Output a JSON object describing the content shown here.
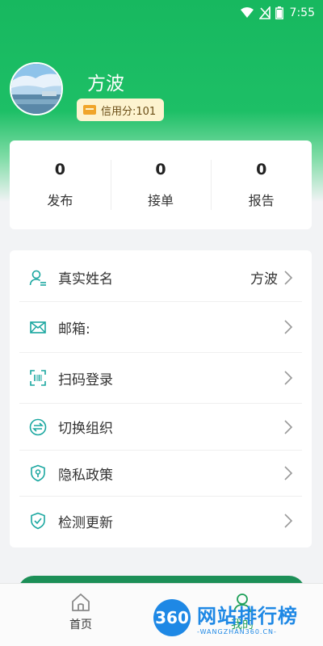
{
  "status_bar": {
    "time": "7:55"
  },
  "profile": {
    "name": "方波",
    "credit": "信用分:101"
  },
  "stats": [
    {
      "value": "0",
      "label": "发布"
    },
    {
      "value": "0",
      "label": "接单"
    },
    {
      "value": "0",
      "label": "报告"
    }
  ],
  "menu": [
    {
      "label": "真实姓名",
      "value": "方波",
      "icon": "user-id-icon"
    },
    {
      "label": "邮箱:",
      "value": "",
      "icon": "mail-icon"
    },
    {
      "label": "扫码登录",
      "value": "",
      "icon": "scan-icon"
    },
    {
      "label": "切换组织",
      "value": "",
      "icon": "switch-icon"
    },
    {
      "label": "隐私政策",
      "value": "",
      "icon": "shield-lock-icon"
    },
    {
      "label": "检测更新",
      "value": "",
      "icon": "shield-check-icon"
    }
  ],
  "tabbar": {
    "home": "首页",
    "mine": "我的"
  },
  "watermark": {
    "logo": "360",
    "title": "网站排行榜",
    "sub": "-WANGZHAN360.CN-"
  },
  "colors": {
    "primary": "#1dbf66",
    "accent_icon": "#1aa7a0",
    "button": "#1c8f57"
  }
}
